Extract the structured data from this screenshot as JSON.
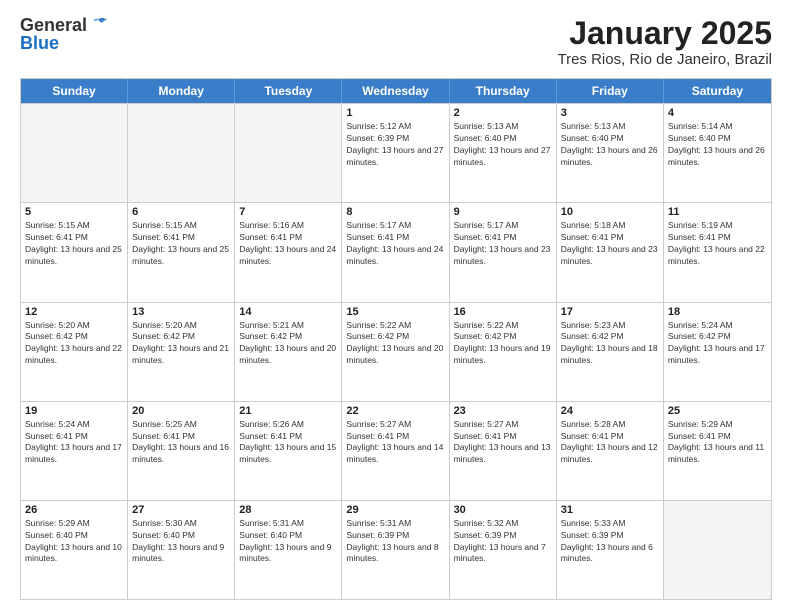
{
  "header": {
    "logo_general": "General",
    "logo_blue": "Blue",
    "title": "January 2025",
    "subtitle": "Tres Rios, Rio de Janeiro, Brazil"
  },
  "calendar": {
    "weekdays": [
      "Sunday",
      "Monday",
      "Tuesday",
      "Wednesday",
      "Thursday",
      "Friday",
      "Saturday"
    ],
    "rows": [
      [
        {
          "day": "",
          "empty": true
        },
        {
          "day": "",
          "empty": true
        },
        {
          "day": "",
          "empty": true
        },
        {
          "day": "1",
          "sunrise": "Sunrise: 5:12 AM",
          "sunset": "Sunset: 6:39 PM",
          "daylight": "Daylight: 13 hours and 27 minutes."
        },
        {
          "day": "2",
          "sunrise": "Sunrise: 5:13 AM",
          "sunset": "Sunset: 6:40 PM",
          "daylight": "Daylight: 13 hours and 27 minutes."
        },
        {
          "day": "3",
          "sunrise": "Sunrise: 5:13 AM",
          "sunset": "Sunset: 6:40 PM",
          "daylight": "Daylight: 13 hours and 26 minutes."
        },
        {
          "day": "4",
          "sunrise": "Sunrise: 5:14 AM",
          "sunset": "Sunset: 6:40 PM",
          "daylight": "Daylight: 13 hours and 26 minutes."
        }
      ],
      [
        {
          "day": "5",
          "sunrise": "Sunrise: 5:15 AM",
          "sunset": "Sunset: 6:41 PM",
          "daylight": "Daylight: 13 hours and 25 minutes."
        },
        {
          "day": "6",
          "sunrise": "Sunrise: 5:15 AM",
          "sunset": "Sunset: 6:41 PM",
          "daylight": "Daylight: 13 hours and 25 minutes."
        },
        {
          "day": "7",
          "sunrise": "Sunrise: 5:16 AM",
          "sunset": "Sunset: 6:41 PM",
          "daylight": "Daylight: 13 hours and 24 minutes."
        },
        {
          "day": "8",
          "sunrise": "Sunrise: 5:17 AM",
          "sunset": "Sunset: 6:41 PM",
          "daylight": "Daylight: 13 hours and 24 minutes."
        },
        {
          "day": "9",
          "sunrise": "Sunrise: 5:17 AM",
          "sunset": "Sunset: 6:41 PM",
          "daylight": "Daylight: 13 hours and 23 minutes."
        },
        {
          "day": "10",
          "sunrise": "Sunrise: 5:18 AM",
          "sunset": "Sunset: 6:41 PM",
          "daylight": "Daylight: 13 hours and 23 minutes."
        },
        {
          "day": "11",
          "sunrise": "Sunrise: 5:19 AM",
          "sunset": "Sunset: 6:41 PM",
          "daylight": "Daylight: 13 hours and 22 minutes."
        }
      ],
      [
        {
          "day": "12",
          "sunrise": "Sunrise: 5:20 AM",
          "sunset": "Sunset: 6:42 PM",
          "daylight": "Daylight: 13 hours and 22 minutes."
        },
        {
          "day": "13",
          "sunrise": "Sunrise: 5:20 AM",
          "sunset": "Sunset: 6:42 PM",
          "daylight": "Daylight: 13 hours and 21 minutes."
        },
        {
          "day": "14",
          "sunrise": "Sunrise: 5:21 AM",
          "sunset": "Sunset: 6:42 PM",
          "daylight": "Daylight: 13 hours and 20 minutes."
        },
        {
          "day": "15",
          "sunrise": "Sunrise: 5:22 AM",
          "sunset": "Sunset: 6:42 PM",
          "daylight": "Daylight: 13 hours and 20 minutes."
        },
        {
          "day": "16",
          "sunrise": "Sunrise: 5:22 AM",
          "sunset": "Sunset: 6:42 PM",
          "daylight": "Daylight: 13 hours and 19 minutes."
        },
        {
          "day": "17",
          "sunrise": "Sunrise: 5:23 AM",
          "sunset": "Sunset: 6:42 PM",
          "daylight": "Daylight: 13 hours and 18 minutes."
        },
        {
          "day": "18",
          "sunrise": "Sunrise: 5:24 AM",
          "sunset": "Sunset: 6:42 PM",
          "daylight": "Daylight: 13 hours and 17 minutes."
        }
      ],
      [
        {
          "day": "19",
          "sunrise": "Sunrise: 5:24 AM",
          "sunset": "Sunset: 6:41 PM",
          "daylight": "Daylight: 13 hours and 17 minutes."
        },
        {
          "day": "20",
          "sunrise": "Sunrise: 5:25 AM",
          "sunset": "Sunset: 6:41 PM",
          "daylight": "Daylight: 13 hours and 16 minutes."
        },
        {
          "day": "21",
          "sunrise": "Sunrise: 5:26 AM",
          "sunset": "Sunset: 6:41 PM",
          "daylight": "Daylight: 13 hours and 15 minutes."
        },
        {
          "day": "22",
          "sunrise": "Sunrise: 5:27 AM",
          "sunset": "Sunset: 6:41 PM",
          "daylight": "Daylight: 13 hours and 14 minutes."
        },
        {
          "day": "23",
          "sunrise": "Sunrise: 5:27 AM",
          "sunset": "Sunset: 6:41 PM",
          "daylight": "Daylight: 13 hours and 13 minutes."
        },
        {
          "day": "24",
          "sunrise": "Sunrise: 5:28 AM",
          "sunset": "Sunset: 6:41 PM",
          "daylight": "Daylight: 13 hours and 12 minutes."
        },
        {
          "day": "25",
          "sunrise": "Sunrise: 5:29 AM",
          "sunset": "Sunset: 6:41 PM",
          "daylight": "Daylight: 13 hours and 11 minutes."
        }
      ],
      [
        {
          "day": "26",
          "sunrise": "Sunrise: 5:29 AM",
          "sunset": "Sunset: 6:40 PM",
          "daylight": "Daylight: 13 hours and 10 minutes."
        },
        {
          "day": "27",
          "sunrise": "Sunrise: 5:30 AM",
          "sunset": "Sunset: 6:40 PM",
          "daylight": "Daylight: 13 hours and 9 minutes."
        },
        {
          "day": "28",
          "sunrise": "Sunrise: 5:31 AM",
          "sunset": "Sunset: 6:40 PM",
          "daylight": "Daylight: 13 hours and 9 minutes."
        },
        {
          "day": "29",
          "sunrise": "Sunrise: 5:31 AM",
          "sunset": "Sunset: 6:39 PM",
          "daylight": "Daylight: 13 hours and 8 minutes."
        },
        {
          "day": "30",
          "sunrise": "Sunrise: 5:32 AM",
          "sunset": "Sunset: 6:39 PM",
          "daylight": "Daylight: 13 hours and 7 minutes."
        },
        {
          "day": "31",
          "sunrise": "Sunrise: 5:33 AM",
          "sunset": "Sunset: 6:39 PM",
          "daylight": "Daylight: 13 hours and 6 minutes."
        },
        {
          "day": "",
          "empty": true
        }
      ]
    ]
  }
}
